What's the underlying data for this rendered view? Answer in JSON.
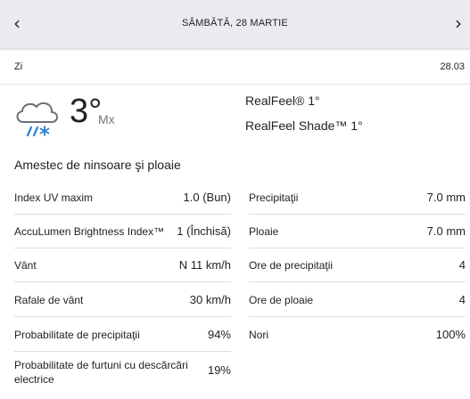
{
  "header": {
    "date": "SÂMBĂTĂ, 28 MARTIE",
    "prev_icon": "chevron-left-icon",
    "next_icon": "chevron-right-icon"
  },
  "day": {
    "label": "Zi",
    "date_short": "28.03",
    "weather_icon": "cloud-sleet-icon",
    "temperature": "3°",
    "temp_suffix": "Mx",
    "realfeel": "RealFeel® 1°",
    "realfeel_shade": "RealFeel Shade™ 1°",
    "phrase": "Amestec de ninsoare şi ploaie"
  },
  "details_left": [
    {
      "label": "Index UV maxim",
      "value": "1.0 (Bun)"
    },
    {
      "label": "AccuLumen Brightness Index™",
      "value": "1 (Închisă)"
    },
    {
      "label": "Vânt",
      "value": "N 11 km/h"
    },
    {
      "label": "Rafale de vânt",
      "value": "30 km/h"
    },
    {
      "label": "Probabilitate de precipitaţii",
      "value": "94%"
    },
    {
      "label": "Probabilitate de furtuni cu descărcări electrice",
      "value": "19%"
    }
  ],
  "details_right": [
    {
      "label": "Precipitaţii",
      "value": "7.0 mm"
    },
    {
      "label": "Ploaie",
      "value": "7.0 mm"
    },
    {
      "label": "Ore de precipitaţii",
      "value": "4"
    },
    {
      "label": "Ore de ploaie",
      "value": "4"
    },
    {
      "label": "Nori",
      "value": "100%"
    }
  ],
  "colors": {
    "accent_blue": "#2d7fd6",
    "header_bg": "#e9ebf1",
    "card_bg": "#ffffff"
  }
}
